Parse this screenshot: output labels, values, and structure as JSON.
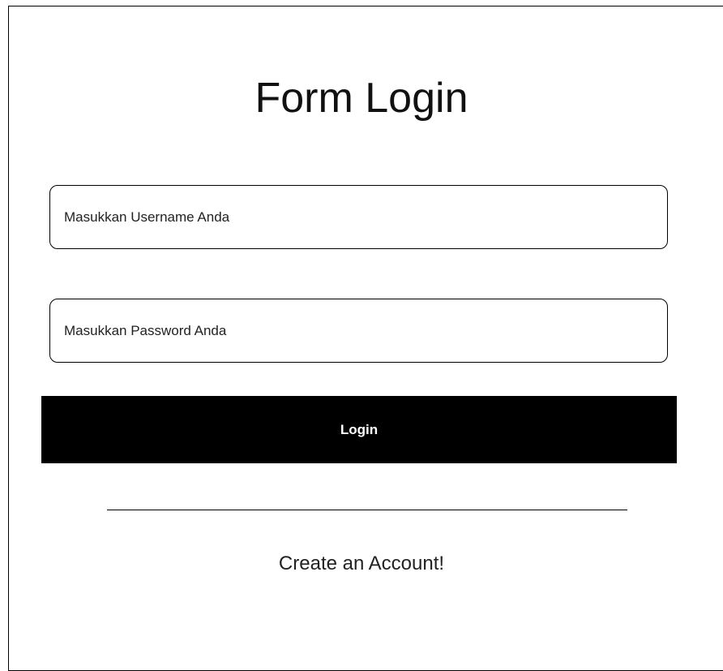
{
  "form": {
    "title": "Form Login",
    "username_placeholder": "Masukkan Username Anda",
    "password_placeholder": "Masukkan Password Anda",
    "login_label": "Login",
    "create_account_label": "Create an Account!"
  },
  "colors": {
    "button_background": "#000000",
    "button_text": "#ffffff",
    "border": "#000000",
    "background": "#ffffff"
  }
}
